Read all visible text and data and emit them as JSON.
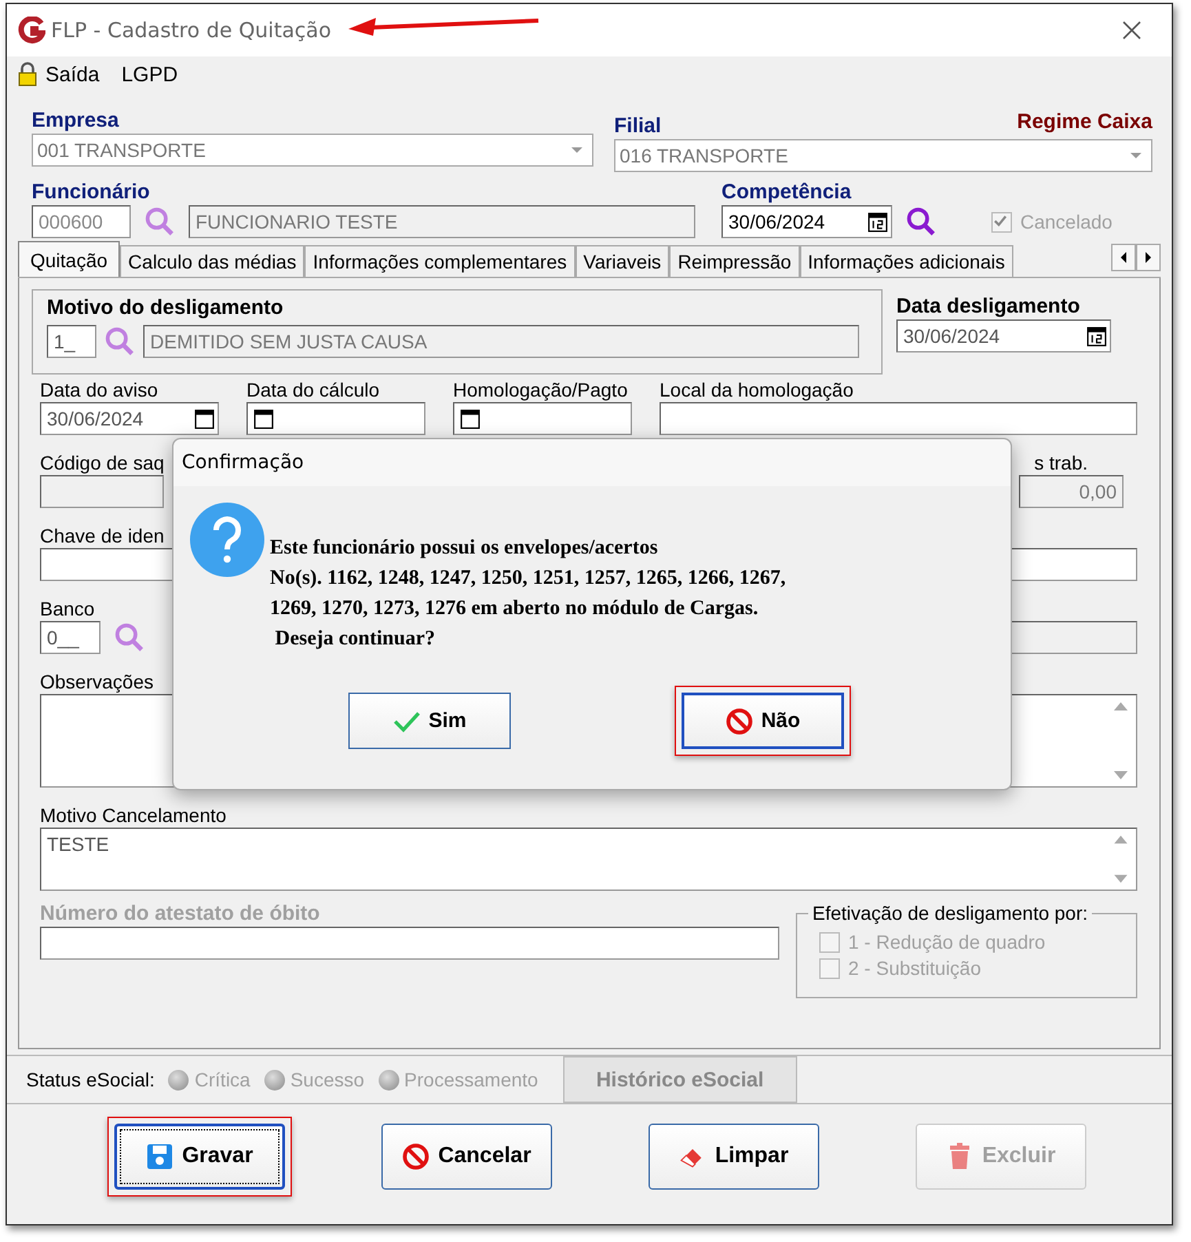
{
  "window": {
    "title": "FLP - Cadastro de Quitação"
  },
  "menu": [
    {
      "label": "Saída",
      "kind": "lock"
    },
    {
      "label": "LGPD",
      "kind": "plain"
    }
  ],
  "header": {
    "empresa": {
      "label": "Empresa",
      "value": "001 TRANSPORTE"
    },
    "filial": {
      "label": "Filial",
      "value": "016 TRANSPORTE"
    },
    "regime": "Regime Caixa",
    "funcionario": {
      "label": "Funcionário",
      "code": "000600",
      "name": "FUNCIONARIO TESTE"
    },
    "competencia": {
      "label": "Competência",
      "value": "30/06/2024"
    },
    "cancelado": {
      "label": "Cancelado",
      "checked": true,
      "disabled": true
    }
  },
  "tabs": [
    {
      "label": "Quitação",
      "selected": true
    },
    {
      "label": "Calculo das médias",
      "selected": false
    },
    {
      "label": "Informações complementares",
      "selected": false
    },
    {
      "label": "Variaveis",
      "selected": false
    },
    {
      "label": "Reimpressão",
      "selected": false
    },
    {
      "label": "Informações adicionais",
      "selected": false
    }
  ],
  "panel": {
    "motivo": {
      "label": "Motivo do desligamento",
      "code": "1_",
      "value": "DEMITIDO SEM JUSTA CAUSA"
    },
    "data_desligamento": {
      "label": "Data desligamento",
      "value": "30/06/2024"
    },
    "dates": [
      {
        "label": "Data do aviso",
        "value": "30/06/2024"
      },
      {
        "label": "Data do cálculo"
      },
      {
        "label": "Homologação/Pagto"
      }
    ],
    "local_label": "Local da homologação",
    "codigo_label": "Código de saq",
    "trab_label": "s trab.",
    "trab_value": "0,00",
    "chave_label": "Chave de iden",
    "banco": {
      "label": "Banco",
      "code": "0__"
    },
    "observacoes_label": "Observações",
    "motivo_cancelamento": {
      "label": "Motivo Cancelamento",
      "value": "TESTE"
    },
    "obito_label": "Número do atestato de óbito",
    "efetivacao": {
      "title": "Efetivação de desligamento por:",
      "options": [
        {
          "label": "1 - Redução de quadro",
          "checked": false,
          "disabled": true
        },
        {
          "label": "2 - Substituição",
          "checked": false,
          "disabled": true
        }
      ]
    }
  },
  "status_bar": {
    "label": "Status eSocial:",
    "indicators": [
      {
        "label": "Crítica",
        "disabled": true
      },
      {
        "label": "Sucesso",
        "disabled": true
      },
      {
        "label": "Processamento",
        "disabled": true
      }
    ],
    "history_button": "Histórico eSocial"
  },
  "buttons": [
    {
      "label": "Gravar",
      "kind": "save",
      "highlighted": true,
      "disabled": false
    },
    {
      "label": "Cancelar",
      "kind": "cancel",
      "highlighted": false,
      "disabled": false
    },
    {
      "label": "Limpar",
      "kind": "eraser",
      "highlighted": false,
      "disabled": false
    },
    {
      "label": "Excluir",
      "kind": "trash",
      "highlighted": false,
      "disabled": true
    }
  ],
  "dialog": {
    "title": "Confirmação",
    "lines": [
      "Este funcionário possui os envelopes/acertos",
      "No(s). 1162, 1248, 1247, 1250, 1251, 1257, 1265, 1266, 1267,",
      "1269, 1270, 1273, 1276 em aberto no módulo de Cargas.",
      " Deseja continuar?"
    ],
    "buttons": [
      {
        "label": "Sim",
        "kind": "yes",
        "highlighted": false
      },
      {
        "label": "Não",
        "kind": "no",
        "highlighted": true
      }
    ]
  }
}
